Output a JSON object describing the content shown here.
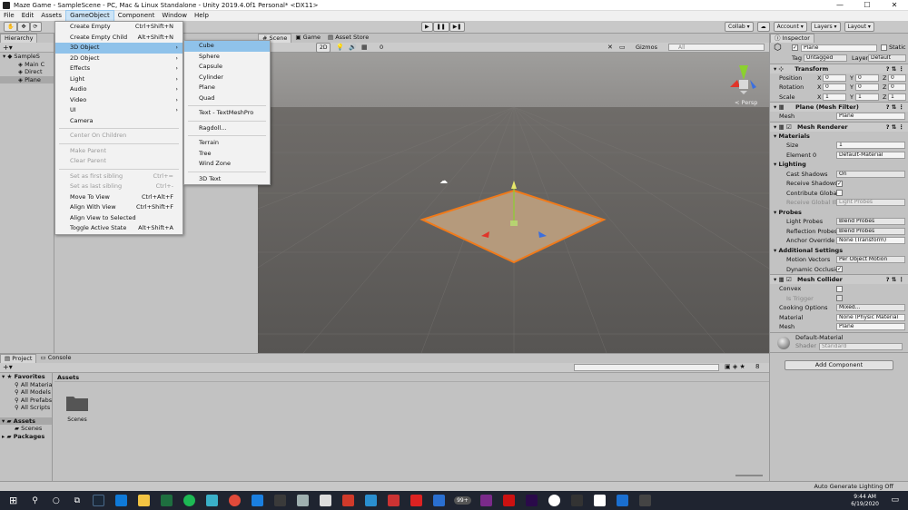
{
  "titlebar": {
    "title": "Maze Game - SampleScene - PC, Mac & Linux Standalone - Unity 2019.4.0f1 Personal* <DX11>",
    "minimize": "—",
    "maximize": "☐",
    "close": "✕"
  },
  "menubar": [
    "File",
    "Edit",
    "Assets",
    "GameObject",
    "Component",
    "Window",
    "Help"
  ],
  "toolbar": {
    "collab": "Collab ▾",
    "account": "Account ▾",
    "layers": "Layers ▾",
    "layout": "Layout ▾"
  },
  "hierarchy": {
    "tab": "Hierarchy",
    "rows": [
      {
        "label": "SampleS",
        "icon": "unity-scene-icon"
      },
      {
        "label": "Main C",
        "icon": "gameobject-icon"
      },
      {
        "label": "Direct",
        "icon": "gameobject-icon"
      },
      {
        "label": "Plane",
        "icon": "gameobject-icon"
      }
    ]
  },
  "gameobject_menu": [
    {
      "label": "Create Empty",
      "shortcut": "Ctrl+Shift+N"
    },
    {
      "label": "Create Empty Child",
      "shortcut": "Alt+Shift+N"
    },
    {
      "label": "3D Object",
      "arrow": "›",
      "highlight": true
    },
    {
      "label": "2D Object",
      "arrow": "›"
    },
    {
      "label": "Effects",
      "arrow": "›"
    },
    {
      "label": "Light",
      "arrow": "›"
    },
    {
      "label": "Audio",
      "arrow": "›"
    },
    {
      "label": "Video",
      "arrow": "›"
    },
    {
      "label": "UI",
      "arrow": "›"
    },
    {
      "label": "Camera"
    },
    {
      "sep": true
    },
    {
      "label": "Center On Children",
      "disabled": true
    },
    {
      "sep": true
    },
    {
      "label": "Make Parent",
      "disabled": true
    },
    {
      "label": "Clear Parent",
      "disabled": true
    },
    {
      "sep": true
    },
    {
      "label": "Set as first sibling",
      "shortcut": "Ctrl+=",
      "disabled": true
    },
    {
      "label": "Set as last sibling",
      "shortcut": "Ctrl+-",
      "disabled": true
    },
    {
      "label": "Move To View",
      "shortcut": "Ctrl+Alt+F"
    },
    {
      "label": "Align With View",
      "shortcut": "Ctrl+Shift+F"
    },
    {
      "label": "Align View to Selected"
    },
    {
      "label": "Toggle Active State",
      "shortcut": "Alt+Shift+A"
    }
  ],
  "submenu_3d": [
    {
      "label": "Cube",
      "highlight": true
    },
    {
      "label": "Sphere"
    },
    {
      "label": "Capsule"
    },
    {
      "label": "Cylinder"
    },
    {
      "label": "Plane"
    },
    {
      "label": "Quad"
    },
    {
      "sep": true
    },
    {
      "label": "Text - TextMeshPro"
    },
    {
      "sep": true
    },
    {
      "label": "Ragdoll..."
    },
    {
      "sep": true
    },
    {
      "label": "Terrain"
    },
    {
      "label": "Tree"
    },
    {
      "label": "Wind Zone"
    },
    {
      "sep": true
    },
    {
      "label": "3D Text"
    }
  ],
  "scene": {
    "tabs": [
      "Scene",
      "Game",
      "Asset Store"
    ],
    "shading": "ded",
    "mode_2d": "2D",
    "fx_count": "0",
    "gizmos": "Gizmos",
    "search_placeholder": "All",
    "persp": "< Persp"
  },
  "inspector": {
    "tab": "Inspector",
    "object_name": "Plane",
    "static_label": "Static",
    "tag_label": "Tag",
    "tag_value": "Untagged",
    "layer_label": "Layer",
    "layer_value": "Default",
    "transform": {
      "title": "Transform",
      "rows": [
        {
          "label": "Position",
          "x": "0",
          "y": "0",
          "z": "0"
        },
        {
          "label": "Rotation",
          "x": "0",
          "y": "0",
          "z": "0"
        },
        {
          "label": "Scale",
          "x": "1",
          "y": "1",
          "z": "1"
        }
      ]
    },
    "mesh_filter": {
      "title": "Plane (Mesh Filter)",
      "mesh_label": "Mesh",
      "mesh_value": "Plane"
    },
    "mesh_renderer": {
      "title": "Mesh Renderer",
      "materials": "Materials",
      "size_label": "Size",
      "size_value": "1",
      "element_label": "Element 0",
      "element_value": "Default-Material",
      "lighting": "Lighting",
      "cast_label": "Cast Shadows",
      "cast_value": "On",
      "receive_label": "Receive Shadows",
      "contrib_label": "Contribute Global I",
      "recv_gi_label": "Receive Global Illu",
      "recv_gi_value": "Light Probes",
      "probes": "Probes",
      "light_probes_label": "Light Probes",
      "light_probes_value": "Blend Probes",
      "refl_label": "Reflection Probes",
      "refl_value": "Blend Probes",
      "anchor_label": "Anchor Override",
      "anchor_value": "None (Transform)",
      "additional": "Additional Settings",
      "motion_label": "Motion Vectors",
      "motion_value": "Per Object Motion",
      "dyn_label": "Dynamic Occlusio"
    },
    "mesh_collider": {
      "title": "Mesh Collider",
      "convex_label": "Convex",
      "trigger_label": "Is Trigger",
      "cooking_label": "Cooking Options",
      "cooking_value": "Mixed...",
      "material_label": "Material",
      "material_value": "None (Physic Material",
      "mesh_label": "Mesh",
      "mesh_value": "Plane"
    },
    "material": {
      "name": "Default-Material",
      "shader_label": "Shader",
      "shader_value": "Standard"
    },
    "add_component": "Add Component"
  },
  "project": {
    "tabs": [
      "Project",
      "Console"
    ],
    "favorites": "Favorites",
    "fav_items": [
      "All Materials",
      "All Models",
      "All Prefabs",
      "All Scripts"
    ],
    "assets": "Assets",
    "assets_children": [
      "Scenes"
    ],
    "packages": "Packages",
    "breadcrumb": "Assets",
    "folder": "Scenes",
    "hidden_count": "8"
  },
  "statusbar": {
    "text": "Auto Generate Lighting Off"
  },
  "taskbar": {
    "time": "9:44 AM",
    "date": "6/19/2020",
    "badge": "99+"
  },
  "colors": {
    "accent": "#8fc2ea",
    "orange": "#f07a1a",
    "scene_bg": "#575553"
  }
}
